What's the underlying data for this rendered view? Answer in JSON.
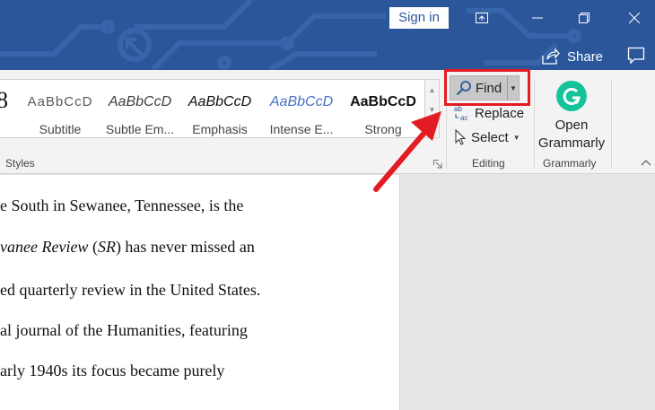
{
  "titlebar": {
    "signin_label": "Sign in",
    "share_label": "Share",
    "colors": {
      "bg": "#2b579a",
      "text": "#ffffff"
    }
  },
  "styles_gallery": {
    "items": [
      {
        "sample": "AaBbCcD",
        "label": "Subtitle"
      },
      {
        "sample": "AaBbCcD",
        "label": "Subtle Em..."
      },
      {
        "sample": "AaBbCcD",
        "label": "Emphasis"
      },
      {
        "sample": "AaBbCcD",
        "label": "Intense E..."
      },
      {
        "sample": "AaBbCcD",
        "label": "Strong"
      }
    ],
    "group_label": "Styles"
  },
  "editing": {
    "find_label": "Find",
    "replace_label": "Replace",
    "select_label": "Select",
    "group_label": "Editing"
  },
  "grammarly": {
    "button_line1": "Open",
    "button_line2": "Grammarly",
    "group_label": "Grammarly",
    "color": "#15c39a"
  },
  "document": {
    "lines": [
      "e South in Sewanee, Tennessee, is the",
      {
        "italic": "vanee Review",
        "rest1": " (",
        "italic2": "SR",
        "rest2": ") has never missed an"
      },
      "ed quarterly review in the United States.",
      "al journal of the Humanities, featuring",
      "arly 1940s its focus became purely"
    ]
  },
  "annotation": {
    "color": "#e31b23"
  }
}
